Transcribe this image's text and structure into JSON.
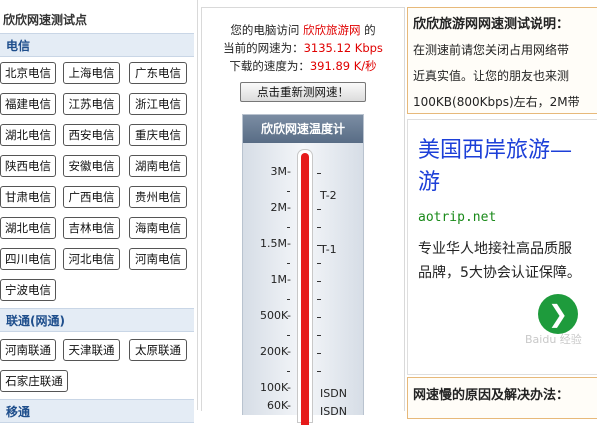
{
  "left": {
    "title": "欣欣网速测试点",
    "sections": [
      {
        "name": "电信",
        "cities": [
          "北京电信",
          "上海电信",
          "广东电信",
          "福建电信",
          "江苏电信",
          "浙江电信",
          "湖北电信",
          "西安电信",
          "重庆电信",
          "陕西电信",
          "安徽电信",
          "湖南电信",
          "甘肃电信",
          "广西电信",
          "贵州电信",
          "湖北电信",
          "吉林电信",
          "海南电信",
          "四川电信",
          "河北电信",
          "河南电信",
          "宁波电信"
        ]
      },
      {
        "name": "联通(网通)",
        "cities": [
          "河南联通",
          "天津联通",
          "太原联通",
          "石家庄联通"
        ]
      },
      {
        "name": "移通",
        "cities": []
      }
    ]
  },
  "middle": {
    "line1_prefix": "您的电脑访问",
    "line1_link": "欣欣旅游网",
    "line1_suffix": "的",
    "line2_prefix": "当前的网速为：",
    "speed_value": "3135.12 Kbps",
    "line3_prefix": "下载的速度为：",
    "download_value": "391.89 K/秒",
    "retest_label": "点击重新测网速！",
    "thermometer": {
      "title": "欣欣网速温度计",
      "scale_labels": [
        "3M-",
        "2M-",
        "1.5M-",
        "1M-",
        "500K-",
        "200K-",
        "100K-",
        "60K-"
      ],
      "right_labels": [
        "T-2",
        "T-1",
        "ISDN",
        "ISDN"
      ],
      "fill_color": "#e61b1b"
    }
  },
  "right": {
    "desc_title": "欣欣旅游网网速测试说明：",
    "desc_lines": [
      "在测速前请您关闭占用网络带",
      "近真实值。让您的朋友也来测",
      "100KB(800Kbps)左右，2M带"
    ],
    "ad": {
      "title_line1": "美国西岸旅游—",
      "title_line2": "游",
      "url": "aotrip.net",
      "text_line1": "专业华人地接社高品质服",
      "text_line2": "品牌，5大协会认证保障。",
      "go_symbol": "❯",
      "brand_color": "#1c3fd8"
    },
    "watermark": "Baidu 经验",
    "reason_title": "网速慢的原因及解决办法："
  }
}
